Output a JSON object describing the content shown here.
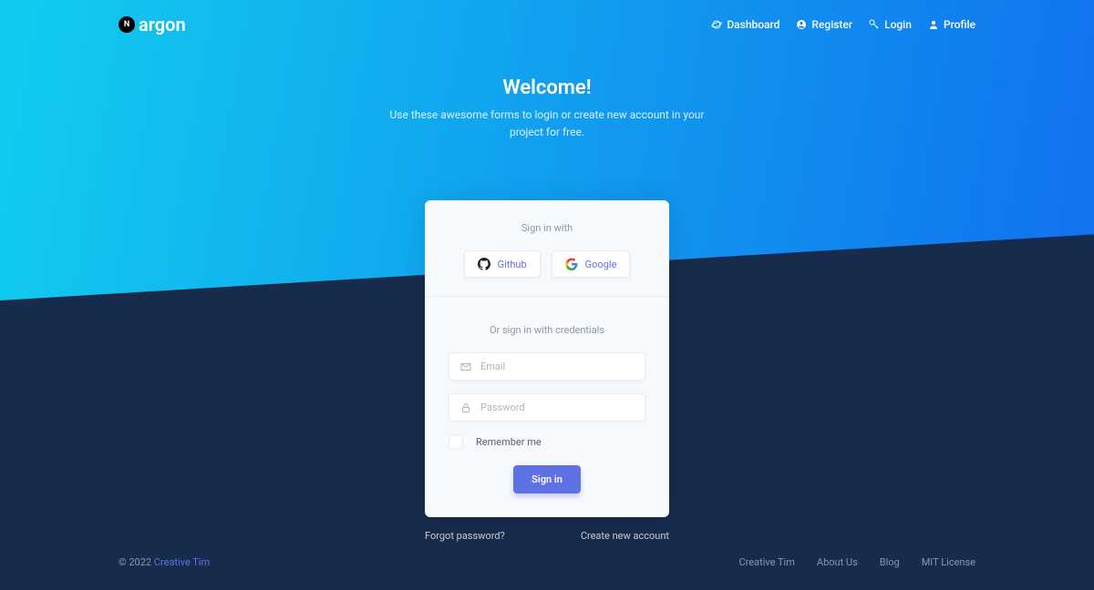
{
  "brand": "argon",
  "nav": {
    "dashboard": "Dashboard",
    "register": "Register",
    "login": "Login",
    "profile": "Profile"
  },
  "hero": {
    "title": "Welcome!",
    "subtitle": "Use these awesome forms to login or create new account in your project for free."
  },
  "card": {
    "signin_with": "Sign in with",
    "github": "Github",
    "google": "Google",
    "credentials": "Or sign in with credentials",
    "email_placeholder": "Email",
    "password_placeholder": "Password",
    "remember": "Remember me",
    "signin_btn": "Sign in"
  },
  "links": {
    "forgot": "Forgot password?",
    "create": "Create new account"
  },
  "footer": {
    "copyright": "© 2022 ",
    "brand": "Creative Tim",
    "nav": {
      "creative": "Creative Tim",
      "about": "About Us",
      "blog": "Blog",
      "license": "MIT License"
    }
  }
}
